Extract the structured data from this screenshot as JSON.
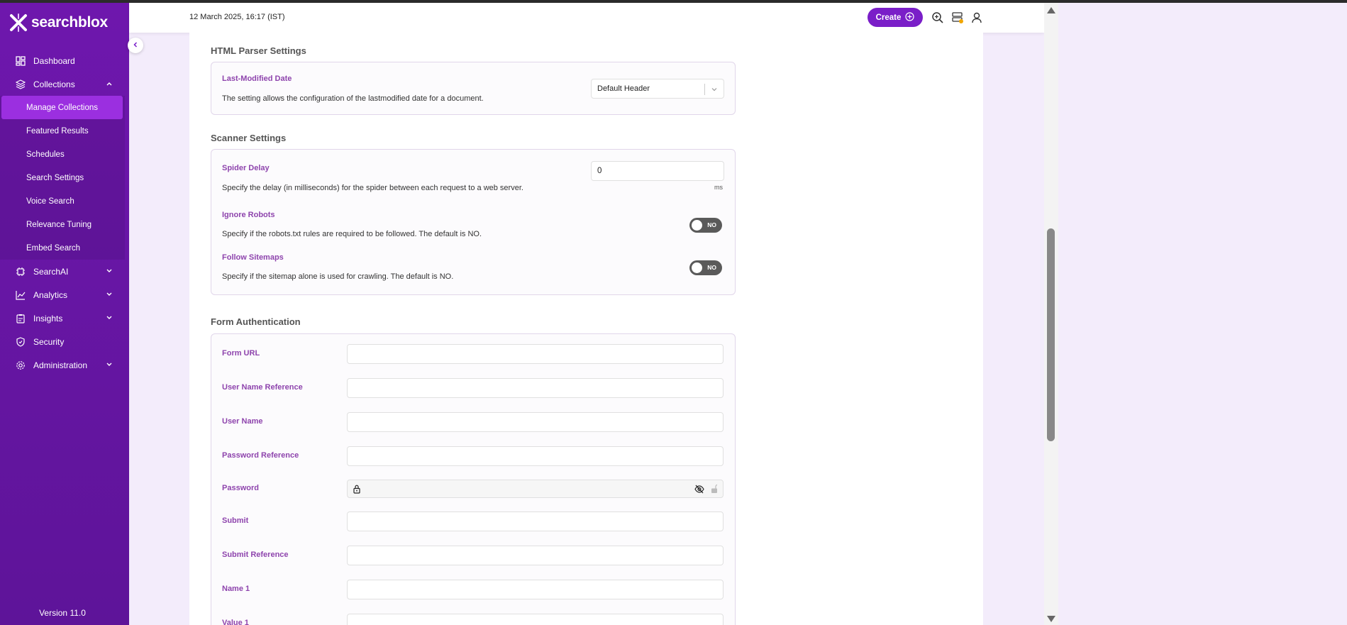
{
  "brand": {
    "name": "searchblox"
  },
  "header": {
    "datetime": "12 March 2025, 16:17 (IST)",
    "create_label": "Create",
    "icons": [
      "search-zoom-icon",
      "server-status-icon",
      "user-icon"
    ]
  },
  "sidebar": {
    "items": [
      {
        "label": "Dashboard",
        "icon": "dashboard-icon"
      },
      {
        "label": "Collections",
        "icon": "layers-icon",
        "expanded": true
      },
      {
        "label": "SearchAI",
        "icon": "chip-icon"
      },
      {
        "label": "Analytics",
        "icon": "chart-icon"
      },
      {
        "label": "Insights",
        "icon": "clipboard-icon"
      },
      {
        "label": "Security",
        "icon": "shield-icon"
      },
      {
        "label": "Administration",
        "icon": "gear-icon"
      }
    ],
    "sub_items": [
      {
        "label": "Manage Collections",
        "active": true
      },
      {
        "label": "Featured Results"
      },
      {
        "label": "Schedules"
      },
      {
        "label": "Search Settings"
      },
      {
        "label": "Voice Search"
      },
      {
        "label": "Relevance Tuning"
      },
      {
        "label": "Embed Search"
      }
    ],
    "version": "Version 11.0"
  },
  "html_parser": {
    "title": "HTML Parser Settings",
    "last_modified": {
      "label": "Last-Modified Date",
      "desc": "The setting allows the configuration of the lastmodified date for a document.",
      "value": "Default Header"
    }
  },
  "scanner": {
    "title": "Scanner Settings",
    "spider_delay": {
      "label": "Spider Delay",
      "desc": "Specify the delay (in milliseconds) for the spider between each request to a web server.",
      "value": "0",
      "unit": "ms"
    },
    "ignore_robots": {
      "label": "Ignore Robots",
      "desc": "Specify if the robots.txt rules are required to be followed. The default is NO.",
      "state": "NO"
    },
    "follow_sitemaps": {
      "label": "Follow Sitemaps",
      "desc": "Specify if the sitemap alone is used for crawling. The default is NO.",
      "state": "NO"
    }
  },
  "form_auth": {
    "title": "Form Authentication",
    "fields": [
      {
        "label": "Form URL",
        "value": ""
      },
      {
        "label": "User Name Reference",
        "value": ""
      },
      {
        "label": "User Name",
        "value": ""
      },
      {
        "label": "Password Reference",
        "value": ""
      },
      {
        "label": "Password",
        "value": ""
      },
      {
        "label": "Submit",
        "value": ""
      },
      {
        "label": "Submit Reference",
        "value": ""
      },
      {
        "label": "Name 1",
        "value": ""
      },
      {
        "label": "Value 1",
        "value": ""
      }
    ]
  },
  "colors": {
    "sidebar": "#6a16a8",
    "active_item": "#9b2fe0",
    "accent": "#7a1ec8",
    "label": "#8e44ad",
    "toggle_off": "#5a5a5a"
  }
}
